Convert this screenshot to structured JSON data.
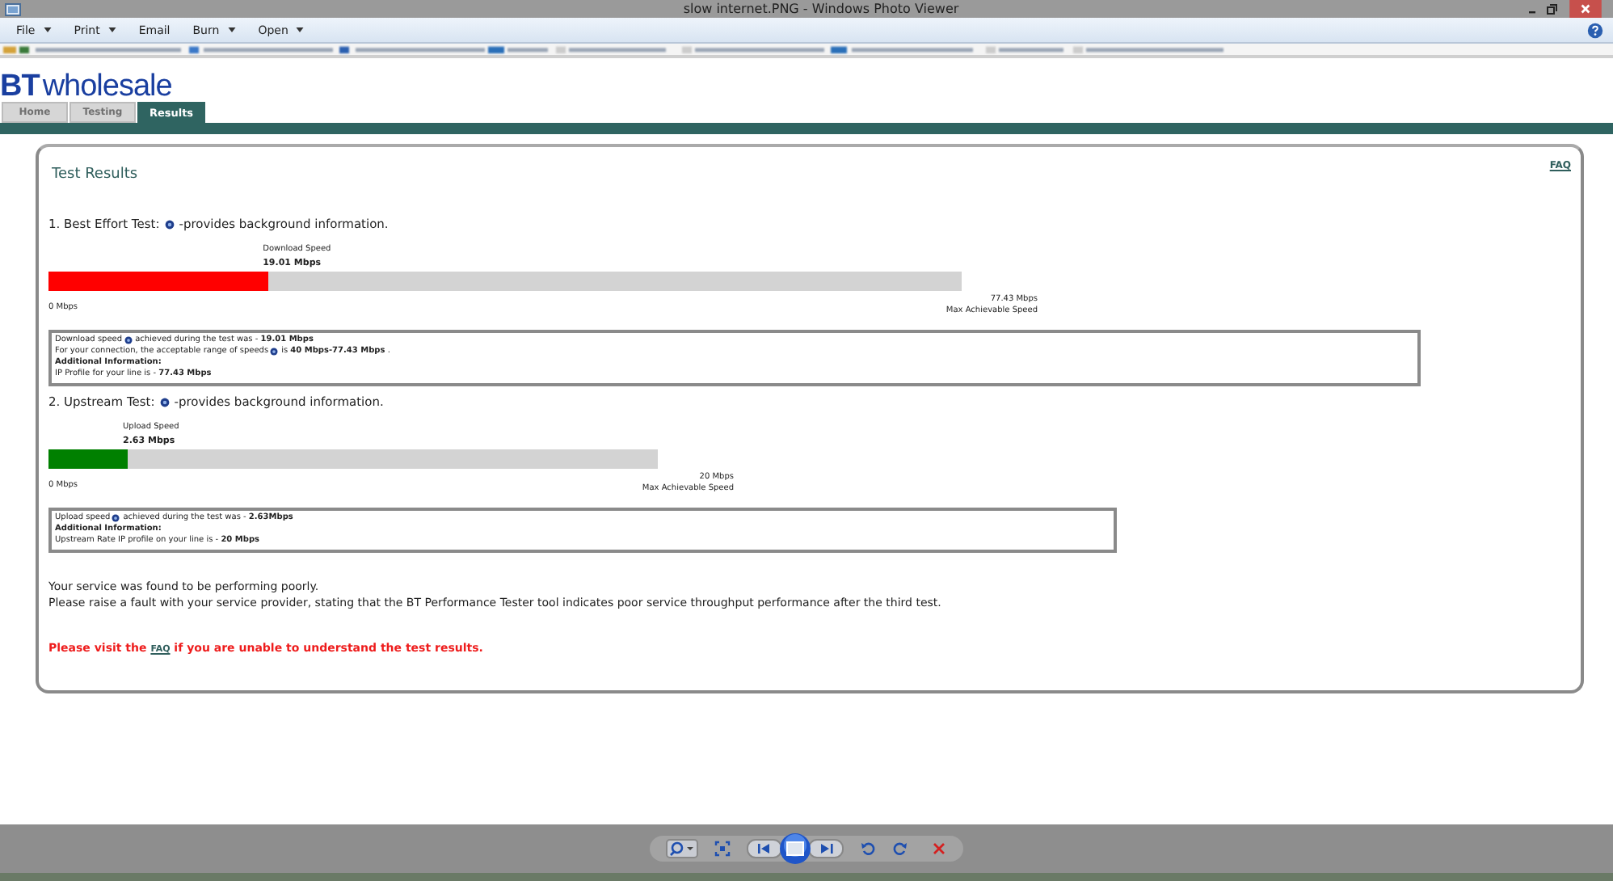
{
  "window": {
    "title": "slow internet.PNG - Windows Photo Viewer"
  },
  "menu": [
    {
      "label": "File",
      "dropdown": true
    },
    {
      "label": "Print",
      "dropdown": true
    },
    {
      "label": "Email",
      "dropdown": false
    },
    {
      "label": "Burn",
      "dropdown": true
    },
    {
      "label": "Open",
      "dropdown": true
    }
  ],
  "page": {
    "logo": {
      "mark": "BT",
      "word": "wholesale"
    },
    "tabs": [
      {
        "label": "Home",
        "selected": false
      },
      {
        "label": "Testing",
        "selected": false
      },
      {
        "label": "Results",
        "selected": true
      }
    ],
    "panel": {
      "title": "Test Results",
      "faq_link": "FAQ",
      "tests": [
        {
          "heading": "1. Best Effort Test:",
          "description": "-provides background information.",
          "speed_label": "Download Speed",
          "speed_value": "19.01 Mbps",
          "level": 0.24,
          "color": "#ff0000",
          "min_label": "0 Mbps",
          "max_value": "77.43 Mbps",
          "max_label": "Max Achievable Speed",
          "info": [
            {
              "kind": "icon_line",
              "label": "Download speed",
              "text": "achieved during the test was - **19.01 Mbps**"
            },
            {
              "kind": "icon_line",
              "label": "For your connection, the acceptable range of speeds",
              "text": "is **40 Mbps-77.43 Mbps** ."
            },
            {
              "kind": "heading",
              "text": "Additional Information:"
            },
            {
              "kind": "plain",
              "text": "IP Profile for your line is - **77.43 Mbps**"
            }
          ]
        },
        {
          "heading": "2. Upstream Test:",
          "description": "-provides background information.",
          "speed_label": "Upload Speed",
          "speed_value": "2.63 Mbps",
          "level": 0.13,
          "color": "#008000",
          "min_label": "0 Mbps",
          "max_value": "20 Mbps",
          "max_label": "Max Achievable Speed",
          "info": [
            {
              "kind": "icon_line",
              "label": "Upload speed",
              "text": "achieved during the test was - **2.63Mbps**"
            },
            {
              "kind": "heading",
              "text": "Additional Information:"
            },
            {
              "kind": "plain",
              "text": "Upstream Rate IP profile on your line is - **20 Mbps**"
            }
          ]
        }
      ],
      "verdict": [
        "Your service was found to be performing poorly.",
        "Please raise a fault with your service provider, stating that the BT Performance Tester tool indicates poor service throughput performance after the third test."
      ],
      "notice": {
        "before": "Please visit the",
        "link": "FAQ",
        "after": "if you are unable to understand the test results."
      }
    }
  }
}
